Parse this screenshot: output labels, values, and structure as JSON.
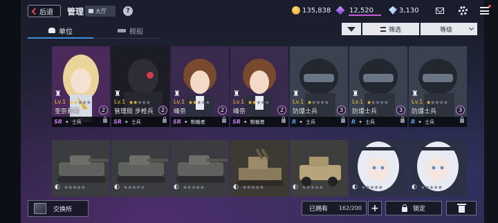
{
  "header": {
    "back_label": "后退",
    "title": "管理",
    "home_label": "大厅",
    "help_label": "?",
    "resources": [
      {
        "icon": "gold-coin-icon",
        "value": "135,838"
      },
      {
        "icon": "purple-gem-icon",
        "value": "12,520"
      },
      {
        "icon": "blue-crystal-icon",
        "value": "3,130"
      }
    ]
  },
  "tabs": [
    {
      "label": "单位",
      "active": true
    },
    {
      "label": "舰船",
      "active": false
    }
  ],
  "toolbar": {
    "filter_label": "筛选",
    "sort_label": "等级"
  },
  "units_row1": [
    {
      "level": "Lv.1",
      "stars": 2,
      "name": "奎奈莉希",
      "badge": "2",
      "rarity": "SR",
      "type": "士兵",
      "portrait": "blonde-girl"
    },
    {
      "level": "Lv.1",
      "stars": 2,
      "name": "管理局 步枪兵",
      "badge": "2",
      "rarity": "SR",
      "type": "士兵",
      "portrait": "armored-soldier"
    },
    {
      "level": "Lv.1",
      "stars": 2,
      "name": "峰奈",
      "badge": "2",
      "rarity": "SR",
      "type": "制裁者",
      "portrait": "brown-hair-boy"
    },
    {
      "level": "Lv.1",
      "stars": 2,
      "name": "峰奈",
      "badge": "2",
      "rarity": "SR",
      "type": "制裁者",
      "portrait": "brown-hair-boy"
    },
    {
      "level": "Lv.1",
      "stars": 1,
      "name": "防爆士兵",
      "badge": "3",
      "rarity": "R",
      "type": "士兵",
      "portrait": "riot-helmet"
    },
    {
      "level": "Lv.1",
      "stars": 1,
      "name": "防爆士兵",
      "badge": "3",
      "rarity": "R",
      "type": "士兵",
      "portrait": "riot-helmet"
    },
    {
      "level": "Lv.1",
      "stars": 1,
      "name": "防爆士兵",
      "badge": "3",
      "rarity": "R",
      "type": "士兵",
      "portrait": "riot-helmet"
    }
  ],
  "units_row2": [
    {
      "portrait": "tank"
    },
    {
      "portrait": "tank"
    },
    {
      "portrait": "tank"
    },
    {
      "portrait": "aa-vehicle"
    },
    {
      "portrait": "armored-truck"
    },
    {
      "portrait": "white-hair-girl"
    },
    {
      "portrait": "white-hair-girl"
    }
  ],
  "footer": {
    "exchange_label": "交换所",
    "owned_label": "已拥有",
    "owned_value": "162/200",
    "plus_label": "+",
    "lock_label": "锁定"
  },
  "colors": {
    "accent_blue": "#3d8fe0",
    "rarity_sr": "#c77be8",
    "rarity_r": "#5a9fea",
    "star_gold": "#f3c23a"
  }
}
